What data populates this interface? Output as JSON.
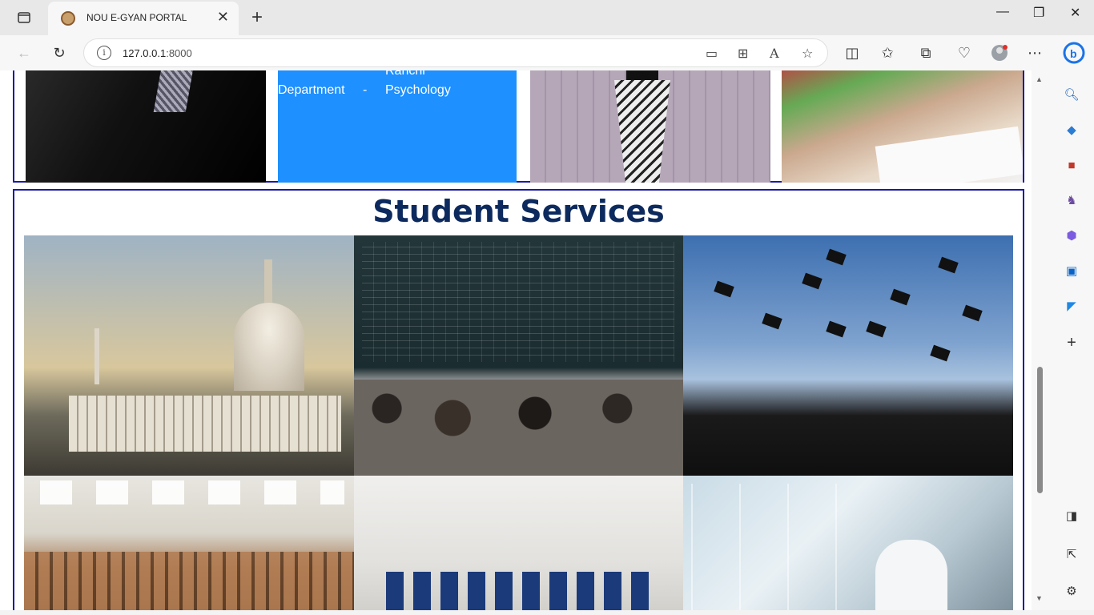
{
  "browser": {
    "tab_title": "NOU E-GYAN PORTAL",
    "new_tab_symbol": "+",
    "tab_close_symbol": "✕",
    "url_host": "127.0.0.1",
    "url_port": ":8000"
  },
  "faculty_strip": {
    "blue_card": {
      "line1": "Ranchi",
      "dept_label": "Department",
      "separator": "-",
      "dept_value": "Psychology"
    }
  },
  "student_services": {
    "title": "Student Services",
    "photos": [
      "capitol-building-photo",
      "lecture-hall-chalkboard-photo",
      "graduation-caps-photo",
      "empty-auditorium-photo",
      "computer-lab-photo",
      "science-laboratory-photo"
    ]
  },
  "colors": {
    "border": "#1a1aa8",
    "title": "#0d2a5e",
    "blue_card": "#1e90ff"
  }
}
